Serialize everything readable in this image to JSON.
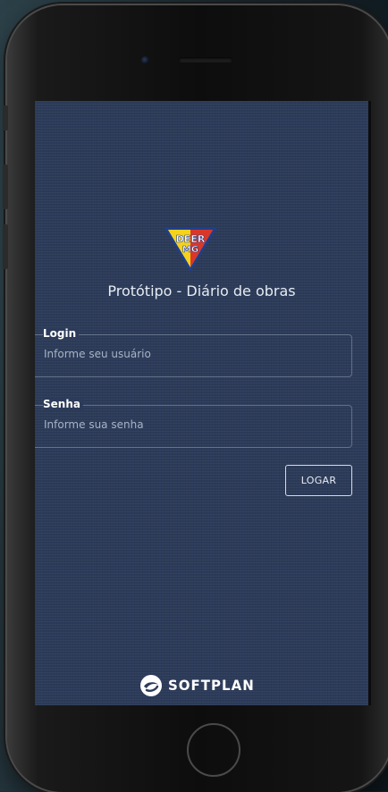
{
  "app": {
    "title": "Protótipo - Diário de obras",
    "logo_text_line1": "DEER",
    "logo_text_line2": "MG"
  },
  "form": {
    "login": {
      "label": "Login",
      "placeholder": "Informe seu usuário",
      "value": ""
    },
    "password": {
      "label": "Senha",
      "placeholder": "Informe sua senha",
      "value": ""
    },
    "submit_label": "LOGAR"
  },
  "footer": {
    "brand": "SOFTPLAN",
    "brand_icon": "softplan-logo-icon"
  },
  "colors": {
    "screen_bg": "#2c3b59",
    "text": "#e6ebf3",
    "logo_yellow": "#f5d21c",
    "logo_red": "#d7262b",
    "logo_blue": "#1d3f8f"
  }
}
